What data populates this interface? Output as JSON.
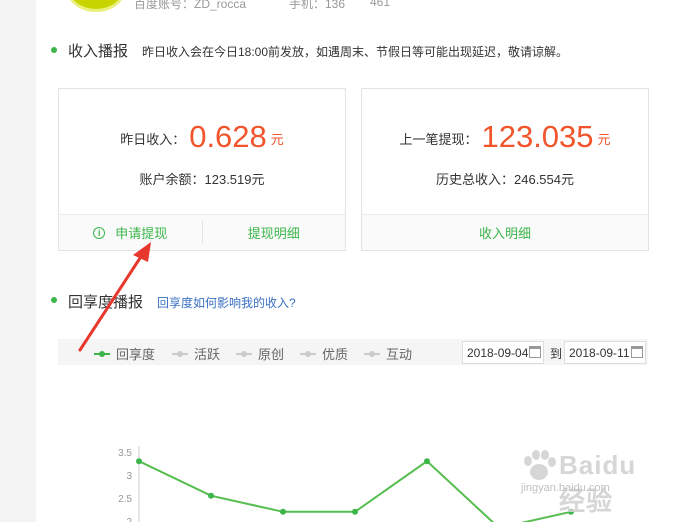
{
  "top": {
    "account": "百度账号：ZD_rocca",
    "stat_a": "手机：136",
    "stat_b": "461"
  },
  "income": {
    "title": "收入播报",
    "note": "昨日收入会在今日18:00前发放，如遇周末、节假日等可能出现延迟，敬请谅解。",
    "cards": [
      {
        "label": "昨日收入：",
        "value": "0.628",
        "unit": "元",
        "sub": "账户余额：123.519元",
        "actions": [
          "申请提现",
          "提现明细"
        ]
      },
      {
        "label": "上一笔提现：",
        "value": "123.035",
        "unit": "元",
        "sub": "历史总收入：246.554元",
        "actions": [
          "收入明细"
        ]
      }
    ]
  },
  "huixiang": {
    "title": "回享度播报",
    "link": "回享度如何影响我的收入?",
    "legend": [
      "回享度",
      "活跃",
      "原创",
      "优质",
      "互动"
    ],
    "date_from": "2018-09-04",
    "to": "到",
    "date_to": "2018-09-11"
  },
  "colors": {
    "accent": "#3cb54a",
    "money": "#f2552c",
    "link": "#3a6fc4",
    "arrow": "#e8372c"
  },
  "chart_data": {
    "type": "line",
    "series": [
      {
        "values": [
          3.3,
          2.55,
          2.2,
          2.2,
          3.3,
          1.85,
          2.2
        ]
      }
    ],
    "y_ticks": [
      "3.5",
      "3",
      "2.5",
      "2"
    ],
    "ylim": [
      2,
      3.5
    ],
    "grid": false
  },
  "watermark": {
    "text": "Baidu经验",
    "url": "jingyan.baidu.com"
  }
}
